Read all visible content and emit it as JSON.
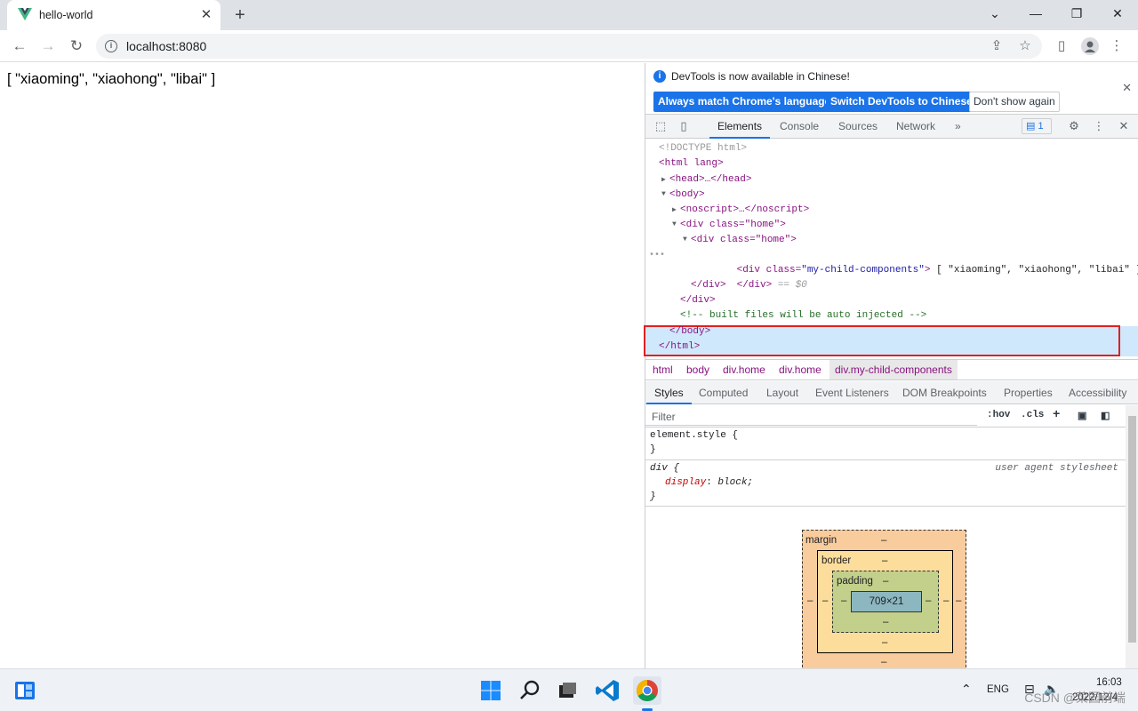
{
  "browser": {
    "tab_title": "hello-world",
    "url": "localhost:8080",
    "close_glyph": "✕",
    "newtab_glyph": "+"
  },
  "page": {
    "content": "[ \"xiaoming\", \"xiaohong\", \"libai\" ]"
  },
  "devtools": {
    "infobar": {
      "message": "DevTools is now available in Chinese!",
      "btn_match": "Always match Chrome's language",
      "btn_switch": "Switch DevTools to Chinese",
      "btn_dont": "Don't show again"
    },
    "tabs": [
      "Elements",
      "Console",
      "Sources",
      "Network"
    ],
    "more_tabs": "»",
    "issues_count": "1",
    "dom": {
      "doctype": "<!DOCTYPE html>",
      "html_open": "<html lang>",
      "head": "<head>…</head>",
      "body_open": "<body>",
      "noscript": "<noscript>…</noscript>",
      "div_home_outer": "<div class=\"home\">",
      "div_home_inner": "<div class=\"home\">",
      "sel_open_tag": "<div class=",
      "sel_class": "\"my-child-components\"",
      "sel_close_bracket": ">",
      "sel_text": " [ \"xiaoming\", \"xiaohong\", \"libai\" ]",
      "sel_close": "</div>",
      "sel_dollar": " == $0",
      "div_close_1": "</div>",
      "div_close_2": "</div>",
      "comment": "<!-- built files will be auto injected -->",
      "body_close": "</body>",
      "html_close": "</html>",
      "ellipsis": "•••"
    },
    "breadcrumbs": [
      "html",
      "body",
      "div.home",
      "div.home",
      "div.my-child-components"
    ],
    "subtabs": [
      "Styles",
      "Computed",
      "Layout",
      "Event Listeners",
      "DOM Breakpoints",
      "Properties",
      "Accessibility"
    ],
    "filter_placeholder": "Filter",
    "hov": ":hov",
    "cls": ".cls",
    "styles": {
      "element_style": "element.style {",
      "close_brace": "}",
      "div_selector": "div {",
      "ua_label": "user agent stylesheet",
      "prop_name": "display",
      "prop_value": "block;"
    },
    "box_model": {
      "margin_label": "margin",
      "border_label": "border",
      "padding_label": "padding",
      "content_size": "709×21",
      "dash": "–"
    }
  },
  "taskbar": {
    "lang": "ENG",
    "time": "16:03",
    "date": "2022/12/4",
    "watermark": "CSDN @菜园前端"
  }
}
